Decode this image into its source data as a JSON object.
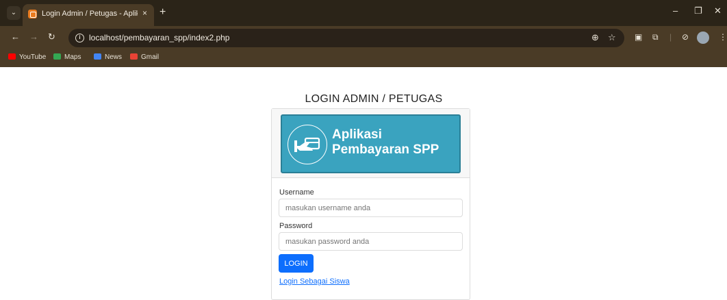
{
  "browser": {
    "tab_title": "Login Admin / Petugas - Aplika",
    "tab_close": "×",
    "new_tab": "+",
    "url": "localhost/pembayaran_spp/index2.php",
    "bookmarks": [
      {
        "label": "YouTube",
        "color": "#ff0000"
      },
      {
        "label": "Maps",
        "color": "#34a853"
      },
      {
        "label": "News",
        "color": "#4285f4"
      },
      {
        "label": "Gmail",
        "color": "#ea4335"
      }
    ]
  },
  "page": {
    "title": "LOGIN ADMIN / PETUGAS",
    "banner": {
      "line1": "Aplikasi",
      "line2": "Pembayaran SPP",
      "color": "#3aa3bf"
    },
    "form": {
      "username_label": "Username",
      "username_placeholder": "masukan username anda",
      "password_label": "Password",
      "password_placeholder": "masukan password anda",
      "login_button": "LOGIN",
      "siswa_link": "Login Sebagai Siswa"
    }
  }
}
